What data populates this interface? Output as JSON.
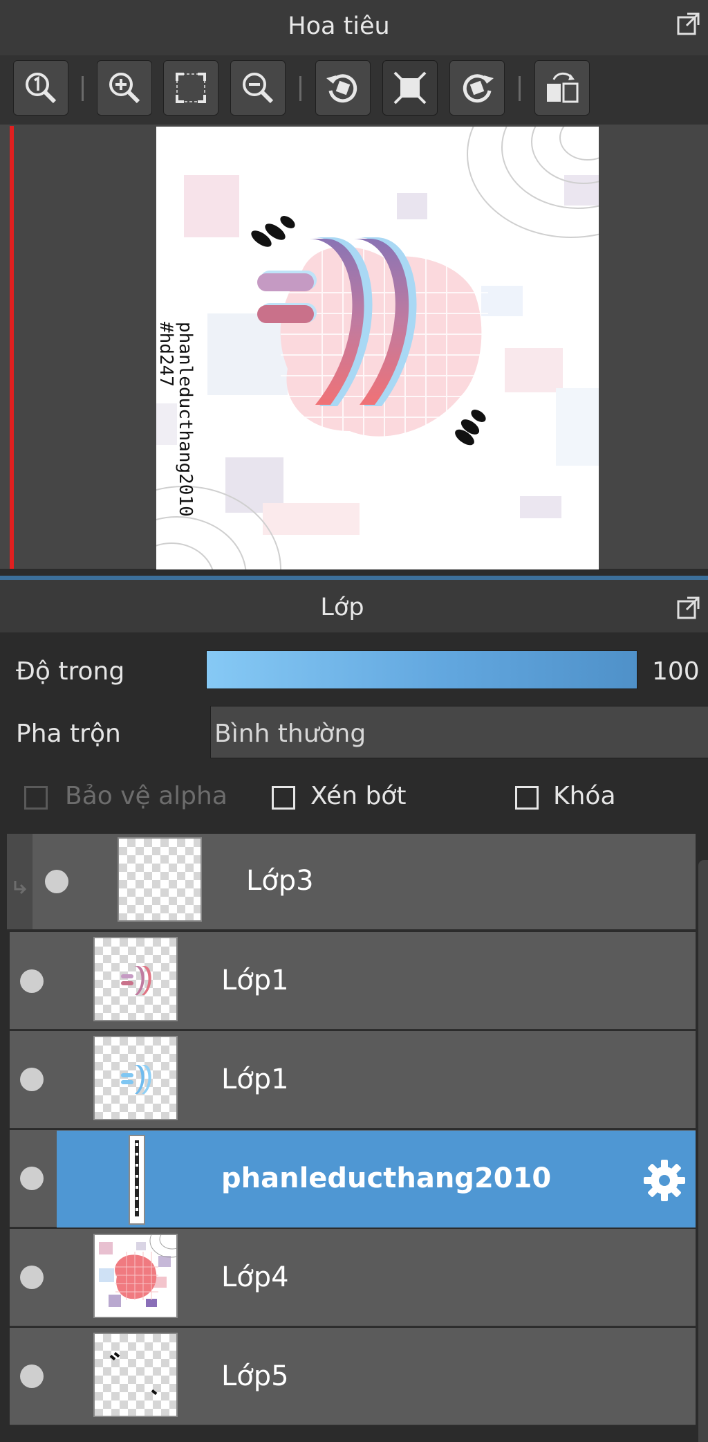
{
  "navigator": {
    "title": "Hoa tiêu",
    "toolbar_icons": [
      "zoom-actual-icon",
      "zoom-in-icon",
      "fit-screen-icon",
      "zoom-out-icon",
      "rotate-left-icon",
      "fit-window-icon",
      "rotate-right-icon",
      "flip-horizontal-icon"
    ],
    "canvas_text": {
      "line1": "phanleducthang2010",
      "line2": "#hd247"
    }
  },
  "layer_panel": {
    "title": "Lớp",
    "opacity_label": "Độ trong",
    "opacity_value": "100 %",
    "opacity_level": 1.0,
    "blend_label": "Pha trộn",
    "blend_value": "Bình thường",
    "protect_alpha_label": "Bảo vệ alpha",
    "clipping_label": "Xén bớt",
    "lock_label": "Khóa",
    "layers": [
      {
        "name": "Lớp3"
      },
      {
        "name": "Lớp1"
      },
      {
        "name": "Lớp1"
      },
      {
        "name": "phanleducthang2010"
      },
      {
        "name": "Lớp4"
      },
      {
        "name": "Lớp5"
      }
    ]
  },
  "colors": {
    "selected_row": "#4f97d3",
    "accent_red": "#e02020"
  }
}
